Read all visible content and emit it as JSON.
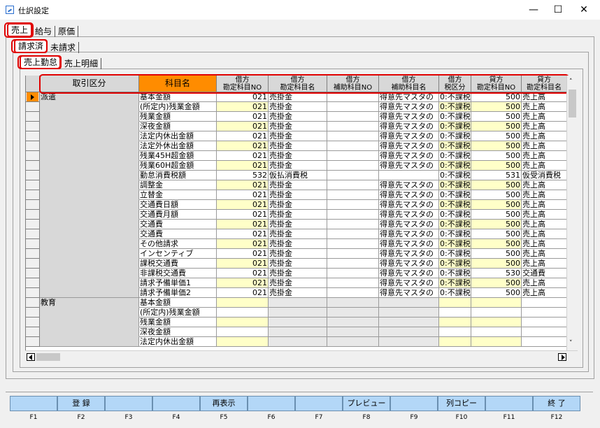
{
  "window": {
    "title": "仕訳設定",
    "minimize": "—",
    "maximize": "☐",
    "close": "✕"
  },
  "tabs_l1": [
    "売上",
    "給与",
    "原価"
  ],
  "tabs_l2": [
    "請求済",
    "未請求"
  ],
  "tabs_l3": [
    "売上勤怠",
    "売上明細"
  ],
  "columns": [
    {
      "label": "取引区分"
    },
    {
      "label": "科目名"
    },
    {
      "label": "借方\n勘定科目NO"
    },
    {
      "label": "借方\n勘定科目名"
    },
    {
      "label": "借方\n補助科目NO"
    },
    {
      "label": "借方\n補助科目名"
    },
    {
      "label": "借方\n税区分"
    },
    {
      "label": "貸方\n勘定科目NO"
    },
    {
      "label": "貸方\n勘定科目名"
    }
  ],
  "groups": [
    "派遣",
    "教育"
  ],
  "rows": [
    [
      "基本金額",
      "021",
      "売掛金",
      "",
      "得意先マスタの",
      "0:不課税",
      "500",
      "売上高"
    ],
    [
      "(所定内)残業金額",
      "021",
      "売掛金",
      "",
      "得意先マスタの",
      "0:不課税",
      "500",
      "売上高"
    ],
    [
      "残業金額",
      "021",
      "売掛金",
      "",
      "得意先マスタの",
      "0:不課税",
      "500",
      "売上高"
    ],
    [
      "深夜金額",
      "021",
      "売掛金",
      "",
      "得意先マスタの",
      "0:不課税",
      "500",
      "売上高"
    ],
    [
      "法定内休出金額",
      "021",
      "売掛金",
      "",
      "得意先マスタの",
      "0:不課税",
      "500",
      "売上高"
    ],
    [
      "法定外休出金額",
      "021",
      "売掛金",
      "",
      "得意先マスタの",
      "0:不課税",
      "500",
      "売上高"
    ],
    [
      "残業45H超金額",
      "021",
      "売掛金",
      "",
      "得意先マスタの",
      "0:不課税",
      "500",
      "売上高"
    ],
    [
      "残業60H超金額",
      "021",
      "売掛金",
      "",
      "得意先マスタの",
      "0:不課税",
      "500",
      "売上高"
    ],
    [
      "勤怠消費税額",
      "532",
      "仮払消費税",
      "",
      "",
      "0:不課税",
      "531",
      "仮受消費税"
    ],
    [
      "調整金",
      "021",
      "売掛金",
      "",
      "得意先マスタの",
      "0:不課税",
      "500",
      "売上高"
    ],
    [
      "立替金",
      "021",
      "売掛金",
      "",
      "得意先マスタの",
      "0:不課税",
      "500",
      "売上高"
    ],
    [
      "交通費日額",
      "021",
      "売掛金",
      "",
      "得意先マスタの",
      "0:不課税",
      "500",
      "売上高"
    ],
    [
      "交通費月額",
      "021",
      "売掛金",
      "",
      "得意先マスタの",
      "0:不課税",
      "500",
      "売上高"
    ],
    [
      "交通費",
      "021",
      "売掛金",
      "",
      "得意先マスタの",
      "0:不課税",
      "500",
      "売上高"
    ],
    [
      "交通費",
      "021",
      "売掛金",
      "",
      "得意先マスタの",
      "0:不課税",
      "500",
      "売上高"
    ],
    [
      "その他請求",
      "021",
      "売掛金",
      "",
      "得意先マスタの",
      "0:不課税",
      "500",
      "売上高"
    ],
    [
      "インセンティブ",
      "021",
      "売掛金",
      "",
      "得意先マスタの",
      "0:不課税",
      "500",
      "売上高"
    ],
    [
      "課税交通費",
      "021",
      "売掛金",
      "",
      "得意先マスタの",
      "0:不課税",
      "500",
      "売上高"
    ],
    [
      "非課税交通費",
      "021",
      "売掛金",
      "",
      "得意先マスタの",
      "0:不課税",
      "530",
      "交通費"
    ],
    [
      "請求予備単価1",
      "021",
      "売掛金",
      "",
      "得意先マスタの",
      "0:不課税",
      "500",
      "売上高"
    ],
    [
      "請求予備単価2",
      "021",
      "売掛金",
      "",
      "得意先マスタの",
      "0:不課税",
      "500",
      "売上高"
    ],
    [
      "基本金額",
      "",
      "",
      "",
      "",
      "",
      "",
      ""
    ],
    [
      "(所定内)残業金額",
      "",
      "",
      "",
      "",
      "",
      "",
      ""
    ],
    [
      "残業金額",
      "",
      "",
      "",
      "",
      "",
      "",
      ""
    ],
    [
      "深夜金額",
      "",
      "",
      "",
      "",
      "",
      "",
      ""
    ],
    [
      "法定内休出金額",
      "",
      "",
      "",
      "",
      "",
      "",
      ""
    ]
  ],
  "fkeys": [
    {
      "num": "F1",
      "label": ""
    },
    {
      "num": "F2",
      "label": "登 録"
    },
    {
      "num": "F3",
      "label": ""
    },
    {
      "num": "F4",
      "label": ""
    },
    {
      "num": "F5",
      "label": "再表示"
    },
    {
      "num": "F6",
      "label": ""
    },
    {
      "num": "F7",
      "label": ""
    },
    {
      "num": "F8",
      "label": "プレビュー"
    },
    {
      "num": "F9",
      "label": ""
    },
    {
      "num": "F10",
      "label": "列コピー"
    },
    {
      "num": "F11",
      "label": ""
    },
    {
      "num": "F12",
      "label": "終 了"
    }
  ],
  "colors": {
    "header_orange": "#ff8c00",
    "highlight_yellow": "#ffffc8",
    "annotation_red": "#e00000",
    "fkey_blue": "#b3d7f7"
  },
  "icons": {
    "selector": "arrow-right-icon",
    "scroll_up": "chevron-up-icon",
    "scroll_down": "chevron-down-icon",
    "scroll_left": "chevron-left-icon",
    "scroll_right": "chevron-right-icon"
  }
}
